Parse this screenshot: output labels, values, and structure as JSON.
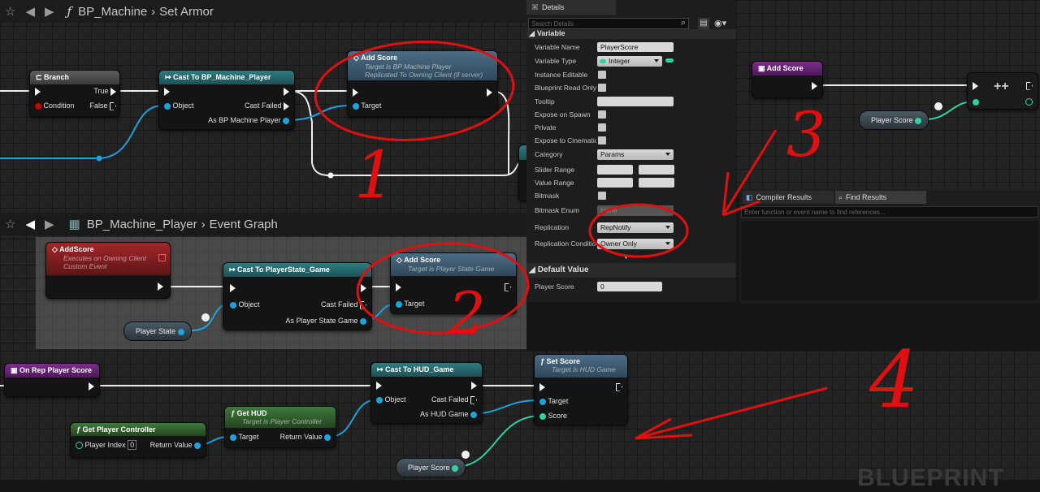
{
  "top_graph": {
    "breadcrumb": {
      "function_icon": "ƒ",
      "blueprint": "BP_Machine",
      "graph": "Set Armor"
    },
    "branch": {
      "title": "Branch",
      "pin_condition": "Condition",
      "pin_true": "True",
      "pin_false": "False"
    },
    "cast": {
      "title": "Cast To BP_Machine_Player",
      "pin_object": "Object",
      "pin_cast_failed": "Cast Failed",
      "pin_as": "As BP Machine Player"
    },
    "add_score": {
      "title": "Add Score",
      "sub1": "Target is BP Machine Player",
      "sub2": "Replicated To Owning Client (if server)",
      "pin_target": "Target"
    }
  },
  "mid_graph": {
    "breadcrumb": {
      "blueprint": "BP_Machine_Player",
      "graph": "Event Graph"
    },
    "event": {
      "title": "AddScore",
      "sub1": "Executes on Owning Client",
      "sub2": "Custom Event"
    },
    "cast": {
      "title": "Cast To PlayerState_Game",
      "pin_object": "Object",
      "pin_cast_failed": "Cast Failed",
      "pin_as": "As Player State Game"
    },
    "add_score": {
      "title": "Add Score",
      "sub1": "Target is Player State Game",
      "pin_target": "Target"
    },
    "var_player_state": "Player State"
  },
  "right_graph": {
    "add_score": {
      "title": "Add Score"
    },
    "increment_symbol": "++",
    "var_player_score": "Player Score"
  },
  "bottom_graph": {
    "on_rep": {
      "title": "On Rep Player Score"
    },
    "cast": {
      "title": "Cast To HUD_Game",
      "pin_object": "Object",
      "pin_cast_failed": "Cast Failed",
      "pin_as": "As HUD Game"
    },
    "set_score": {
      "title": "Set Score",
      "sub1": "Target is HUD Game",
      "pin_target": "Target",
      "pin_score": "Score"
    },
    "get_hud": {
      "title": "Get HUD",
      "sub1": "Target is Player Controller",
      "pin_target": "Target",
      "pin_return": "Return Value"
    },
    "get_pc": {
      "title": "Get Player Controller",
      "pin_index": "Player Index",
      "index_value": "0",
      "pin_return": "Return Value"
    },
    "var_player_score": "Player Score",
    "watermark": "BLUEPRINT"
  },
  "details": {
    "tab": "Details",
    "search_placeholder": "Search Details",
    "section_variable": "Variable",
    "rows": {
      "variable_name": {
        "label": "Variable Name",
        "value": "PlayerScore"
      },
      "variable_type": {
        "label": "Variable Type",
        "value": "Integer"
      },
      "instance_editable": {
        "label": "Instance Editable"
      },
      "blueprint_read_only": {
        "label": "Blueprint Read Only"
      },
      "tooltip": {
        "label": "Tooltip",
        "value": ""
      },
      "expose_on_spawn": {
        "label": "Expose on Spawn"
      },
      "private": {
        "label": "Private"
      },
      "expose_to_cinematics": {
        "label": "Expose to Cinematics"
      },
      "category": {
        "label": "Category",
        "value": "Params"
      },
      "slider_range": {
        "label": "Slider Range"
      },
      "value_range": {
        "label": "Value Range"
      },
      "bitmask": {
        "label": "Bitmask"
      },
      "bitmask_enum": {
        "label": "Bitmask Enum",
        "value": "None"
      },
      "replication": {
        "label": "Replication",
        "value": "RepNotify"
      },
      "replication_condition": {
        "label": "Replication Condition",
        "value": "Owner Only"
      }
    },
    "section_default": "Default Value",
    "default_row": {
      "label": "Player Score",
      "value": "0"
    }
  },
  "results": {
    "tab_compiler": "Compiler Results",
    "tab_find": "Find Results",
    "search_placeholder": "Enter function or event name to find references..."
  },
  "annotations": {
    "n1": "1",
    "n2": "2",
    "n3": "3",
    "n4": "4"
  },
  "colors": {
    "exec": "#f2f2f2",
    "object_pin": "#1ea2dc",
    "int_pin": "#2ed3a0",
    "annotation": "#e01010",
    "teal_header": "#2e7d80",
    "event_header": "#a3262a"
  }
}
